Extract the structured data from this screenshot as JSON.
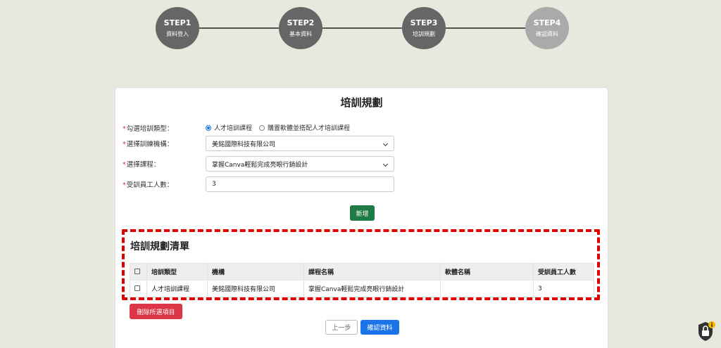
{
  "steps": [
    {
      "num": "STEP1",
      "label": "資料登入",
      "active": true
    },
    {
      "num": "STEP2",
      "label": "基本資料",
      "active": true
    },
    {
      "num": "STEP3",
      "label": "培訓規劃",
      "active": true
    },
    {
      "num": "STEP4",
      "label": "確認資料",
      "active": false
    }
  ],
  "card": {
    "title": "培訓規劃",
    "form": {
      "type_label": "勾選培訓類型：",
      "type_options": [
        "人才培訓課程",
        "購置軟體並搭配人才培訓課程"
      ],
      "type_selected": "人才培訓課程",
      "org_label": "選擇訓練機構：",
      "org_value": "美銘國際科技有限公司",
      "course_label": "選擇課程：",
      "course_value": "掌握Canva輕鬆完成亮眼行銷設計",
      "count_label": "受訓員工人數：",
      "count_value": "3"
    },
    "add_button": "新增",
    "list": {
      "title": "培訓規劃清單",
      "columns": [
        "培訓類型",
        "機構",
        "課程名稱",
        "軟體名稱",
        "受訓員工人數"
      ],
      "rows": [
        [
          "人才培訓課程",
          "美銘國際科技有限公司",
          "掌握Canva輕鬆完成亮眼行銷設計",
          "",
          "3"
        ]
      ]
    },
    "delete_button": "刪除所選項目",
    "prev_button": "上一步",
    "confirm_button": "確認資料"
  },
  "colors": {
    "step_active": "#666666",
    "step_inactive": "#aaaaaa",
    "add_green": "#1f7a45",
    "delete_red": "#dc3545",
    "confirm_blue": "#1a73e8",
    "highlight_red": "#e00000"
  },
  "icons": {
    "lock_badge": "lock-info-icon"
  }
}
